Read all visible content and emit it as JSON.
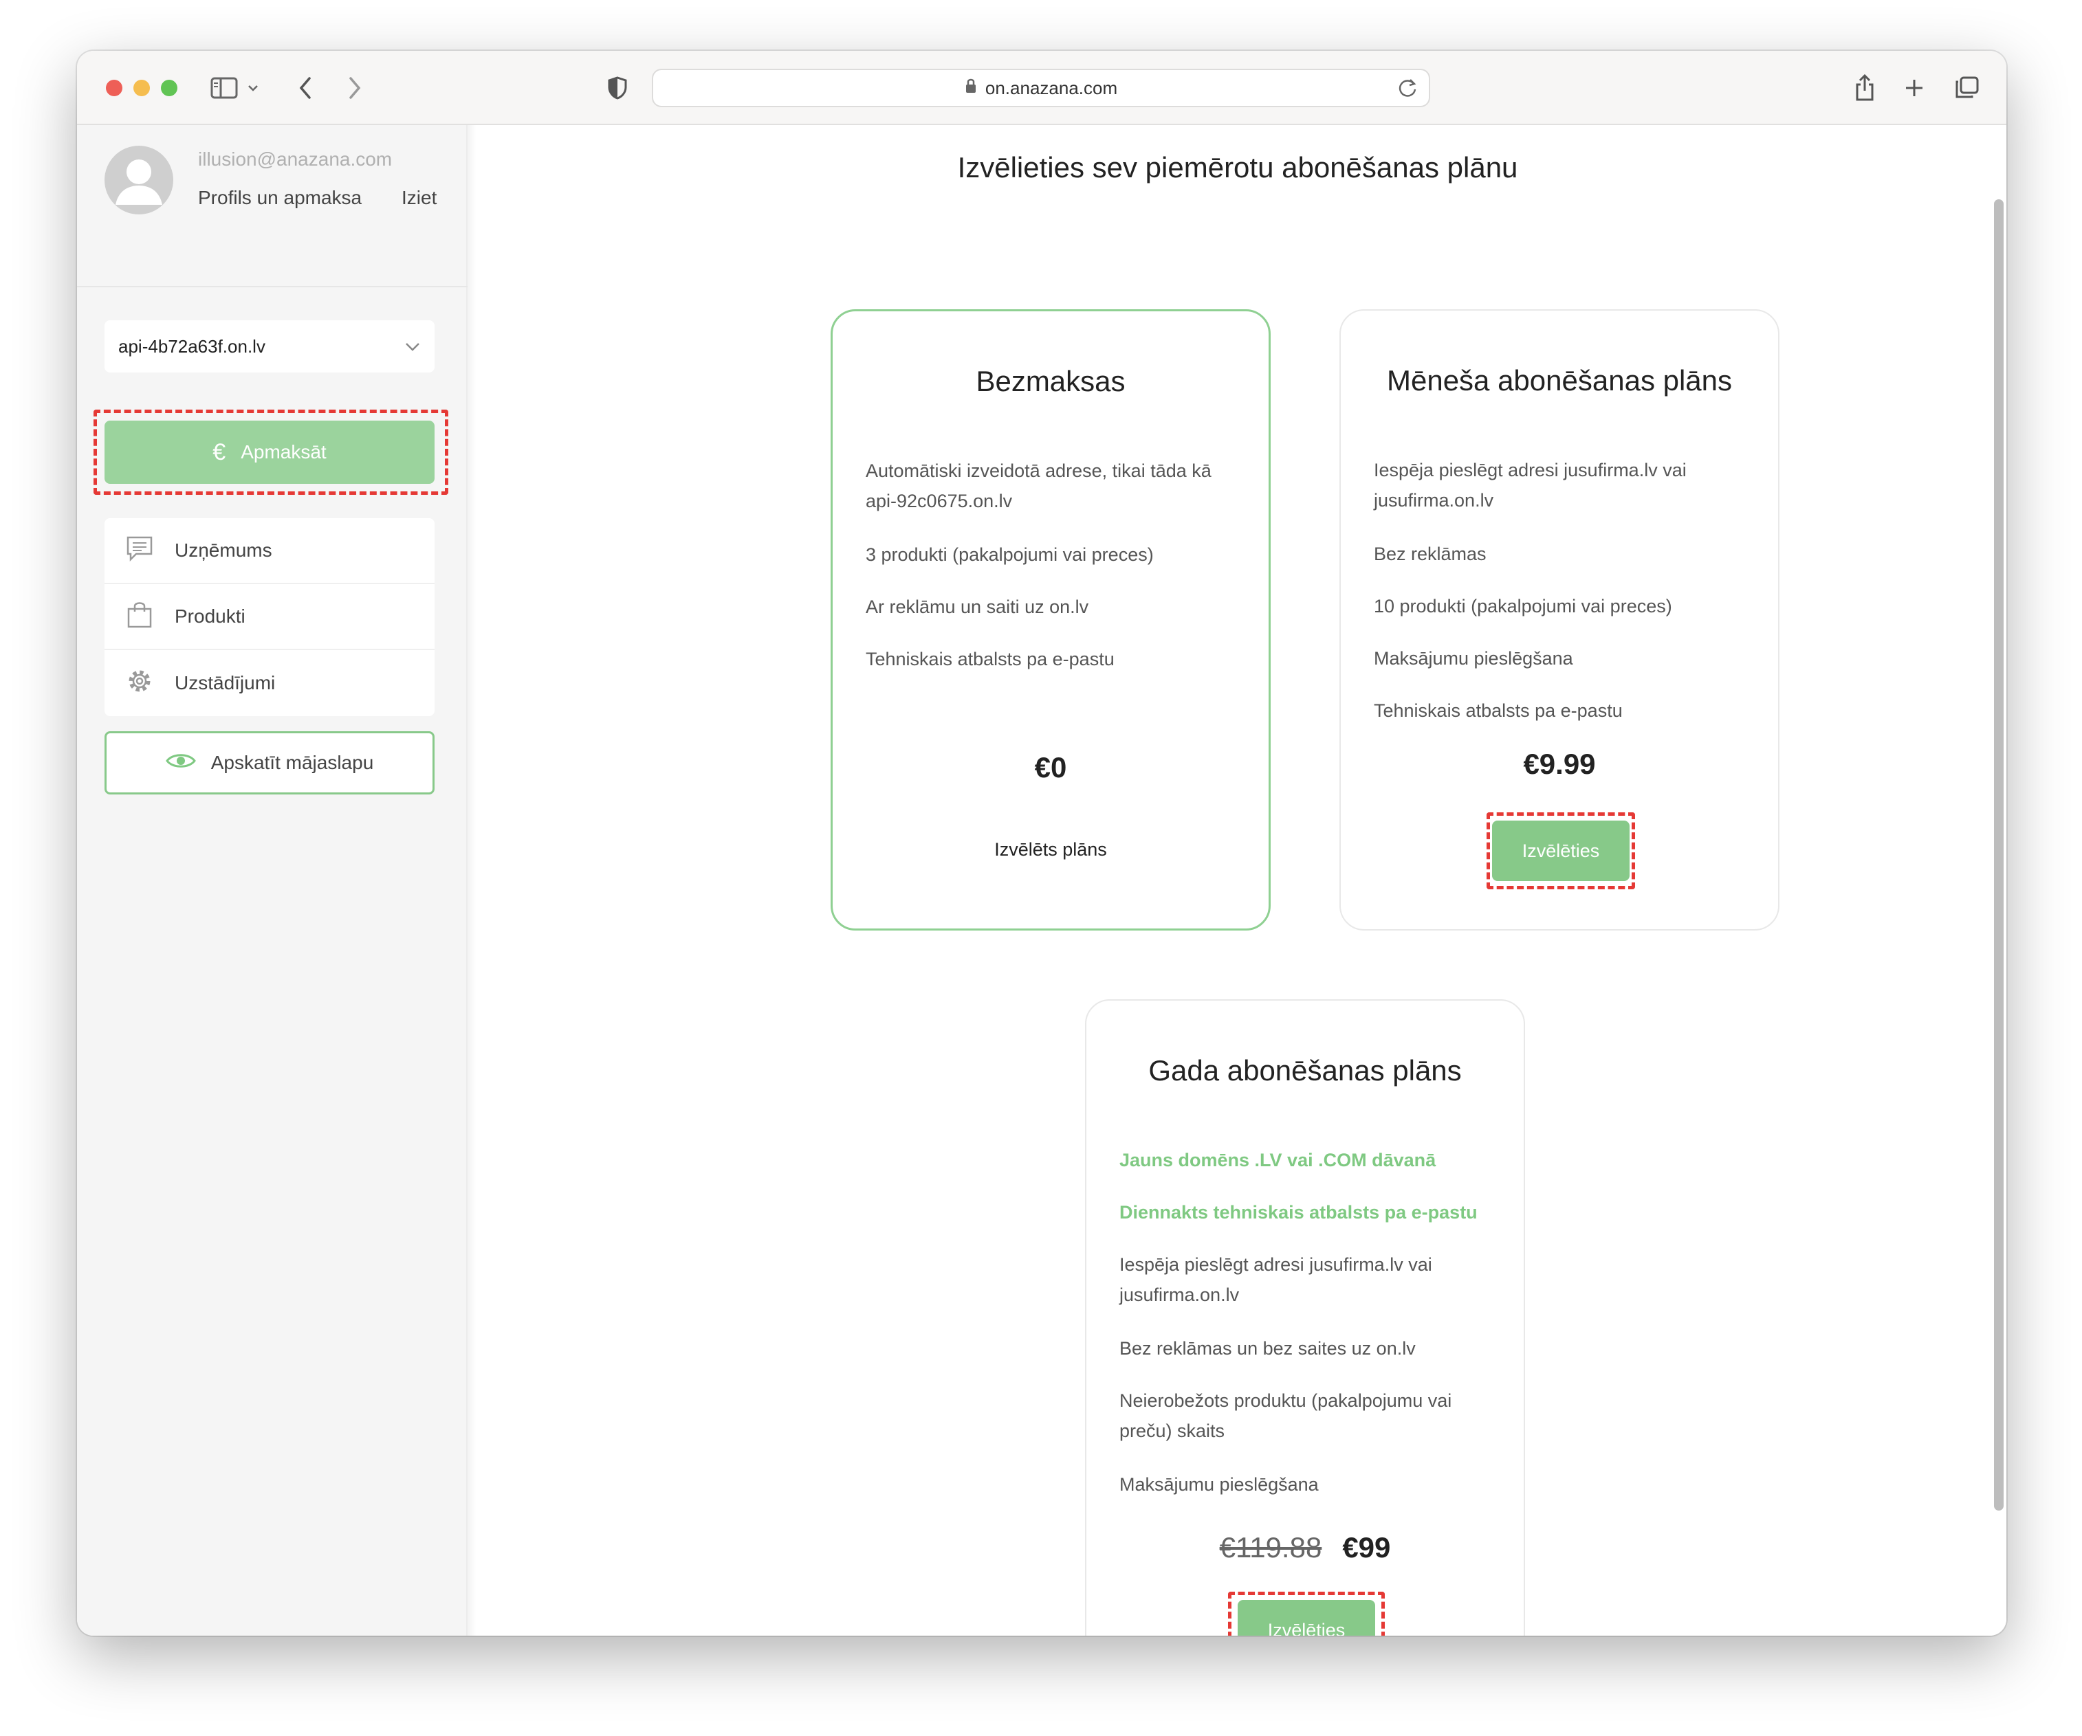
{
  "browser": {
    "url": "on.anazana.com"
  },
  "sidebar": {
    "email": "illusion@anazana.com",
    "profile_link": "Profils un apmaksa",
    "logout_link": "Iziet",
    "site_select": "api-4b72a63f.on.lv",
    "pay_button": "Apmaksāt",
    "pay_icon": "€",
    "menu": [
      {
        "label": "Uzņēmums",
        "icon": "chat-icon"
      },
      {
        "label": "Produkti",
        "icon": "shopping-bag-icon"
      },
      {
        "label": "Uzstādījumi",
        "icon": "gear-icon"
      }
    ],
    "view_site_button": "Apskatīt mājaslapu"
  },
  "main": {
    "title": "Izvēlieties sev piemērotu abonēšanas plānu",
    "plans": [
      {
        "title": "Bezmaksas",
        "features": [
          "Automātiski izveidotā adrese, tikai tāda kā api-92c0675.on.lv",
          "3 produkti (pakalpojumi vai preces)",
          "Ar reklāmu un saiti uz on.lv",
          "Tehniskais atbalsts pa e-pastu"
        ],
        "price": "€0",
        "status": "Izvēlēts plāns"
      },
      {
        "title": "Mēneša abonēšanas plāns",
        "features": [
          "Iespēja pieslēgt adresi jusufirma.lv vai jusufirma.on.lv",
          "Bez reklāmas",
          "10 produkti (pakalpojumi vai preces)",
          "Maksājumu pieslēgšana",
          "Tehniskais atbalsts pa e-pastu"
        ],
        "price": "€9.99",
        "button": "Izvēlēties"
      },
      {
        "title": "Gada abonēšanas plāns",
        "highlights": [
          "Jauns domēns .LV vai .COM dāvanā",
          "Diennakts tehniskais atbalsts pa e-pastu"
        ],
        "features": [
          "Iespēja pieslēgt adresi jusufirma.lv vai jusufirma.on.lv",
          "Bez reklāmas un bez saites uz on.lv",
          "Neierobežots produktu (pakalpojumu vai preču) skaits",
          "Maksājumu pieslēgšana"
        ],
        "old_price": "€119.88",
        "price": "€99",
        "button": "Izvēlēties"
      }
    ]
  },
  "colors": {
    "accent_green": "#87c989",
    "highlight_red": "#e53935"
  }
}
